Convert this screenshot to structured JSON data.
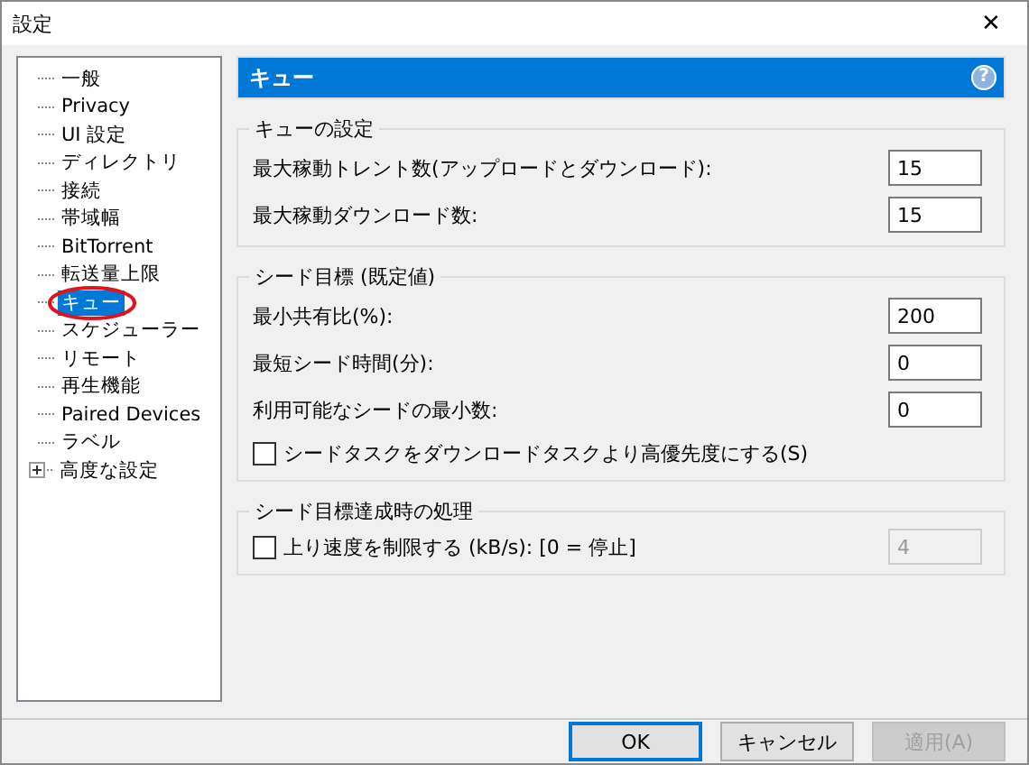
{
  "window": {
    "title": "設定",
    "close": "✕"
  },
  "tree": [
    {
      "label": "一般",
      "selected": false
    },
    {
      "label": "Privacy",
      "selected": false
    },
    {
      "label": "UI 設定",
      "selected": false
    },
    {
      "label": "ディレクトリ",
      "selected": false
    },
    {
      "label": "接続",
      "selected": false
    },
    {
      "label": "帯域幅",
      "selected": false
    },
    {
      "label": "BitTorrent",
      "selected": false
    },
    {
      "label": "転送量上限",
      "selected": false
    },
    {
      "label": "キュー",
      "selected": true
    },
    {
      "label": "スケジューラー",
      "selected": false
    },
    {
      "label": "リモート",
      "selected": false
    },
    {
      "label": "再生機能",
      "selected": false
    },
    {
      "label": "Paired Devices",
      "selected": false
    },
    {
      "label": "ラベル",
      "selected": false
    },
    {
      "label": "高度な設定",
      "selected": false,
      "expandable": true,
      "expanded": false
    }
  ],
  "panel": {
    "title": "キュー",
    "help": "?"
  },
  "groups": [
    {
      "title": "キューの設定",
      "rows": [
        {
          "kind": "number",
          "label": "最大稼動トレント数(アップロードとダウンロード):",
          "value": "15",
          "disabled": false
        },
        {
          "kind": "number",
          "label": "最大稼動ダウンロード数:",
          "value": "15",
          "disabled": false
        }
      ]
    },
    {
      "title": "シード目標 (既定値)",
      "rows": [
        {
          "kind": "number",
          "label": "最小共有比(%):",
          "value": "200",
          "disabled": false
        },
        {
          "kind": "number",
          "label": "最短シード時間(分):",
          "value": "0",
          "disabled": false
        },
        {
          "kind": "number",
          "label": "利用可能なシードの最小数:",
          "value": "0",
          "disabled": false
        },
        {
          "kind": "checkbox",
          "label": "シードタスクをダウンロードタスクより高優先度にする(S)",
          "checked": false
        }
      ]
    },
    {
      "title": "シード目標達成時の処理",
      "rows": [
        {
          "kind": "checkbox-number",
          "label": "上り速度を制限する (kB/s): [0 = 停止]",
          "checked": false,
          "value": "4",
          "disabled": true
        }
      ]
    }
  ],
  "buttons": [
    {
      "label": "OK",
      "default": true,
      "disabled": false
    },
    {
      "label": "キャンセル",
      "default": false,
      "disabled": false
    },
    {
      "label": "適用(A)",
      "default": false,
      "disabled": true
    }
  ]
}
